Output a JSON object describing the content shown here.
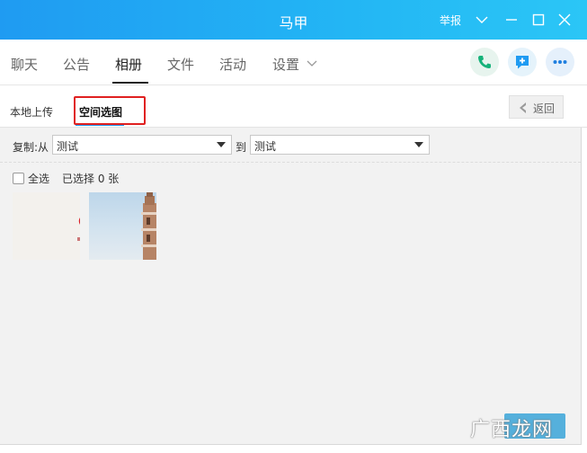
{
  "window": {
    "title": "马甲",
    "report_label": "举报"
  },
  "tabs": [
    {
      "label": "聊天"
    },
    {
      "label": "公告"
    },
    {
      "label": "相册"
    },
    {
      "label": "文件"
    },
    {
      "label": "活动"
    },
    {
      "label": "设置"
    }
  ],
  "active_tab": "相册",
  "header_actions": [
    "phone-icon",
    "message-add-icon",
    "more-icon"
  ],
  "subtabs": {
    "local_upload": "本地上传",
    "space_select": "空间选图",
    "back": "返回"
  },
  "copy": {
    "from_label": "复制:从",
    "from_value": "测试",
    "to_label": "到",
    "to_value": "测试"
  },
  "selection": {
    "select_all": "全选",
    "selected_text": "已选择 0 张"
  },
  "watermark": "广西龙网",
  "colors": {
    "accent": "#1f9bf2",
    "highlight_box": "#e02020"
  }
}
